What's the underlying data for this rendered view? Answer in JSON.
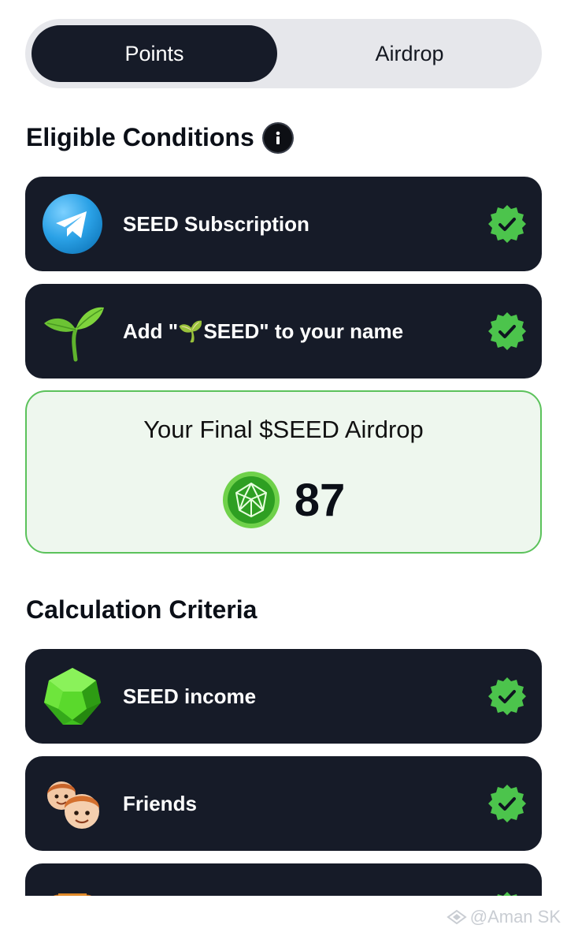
{
  "tabs": [
    {
      "label": "Points",
      "active": true
    },
    {
      "label": "Airdrop",
      "active": false
    }
  ],
  "eligible": {
    "title": "Eligible Conditions",
    "items": [
      {
        "label": "SEED Subscription",
        "icon": "telegram-icon",
        "checked": true
      },
      {
        "label": "Add \"🌱SEED\" to your name",
        "icon": "sprout-icon",
        "checked": true
      }
    ]
  },
  "airdrop": {
    "title": "Your Final $SEED Airdrop",
    "value": "87",
    "icon": "seed-coin-icon"
  },
  "criteria": {
    "title": "Calculation Criteria",
    "items": [
      {
        "label": "SEED income",
        "icon": "gem-icon",
        "checked": true
      },
      {
        "label": "Friends",
        "icon": "friends-icon",
        "checked": true
      },
      {
        "label": "",
        "icon": "trophy-icon",
        "checked": true
      }
    ]
  },
  "watermark": "@Aman SK",
  "colors": {
    "card_bg": "#161b28",
    "check_green": "#4cc44c",
    "airdrop_bg": "#eef7ee",
    "airdrop_border": "#5bc25b"
  }
}
